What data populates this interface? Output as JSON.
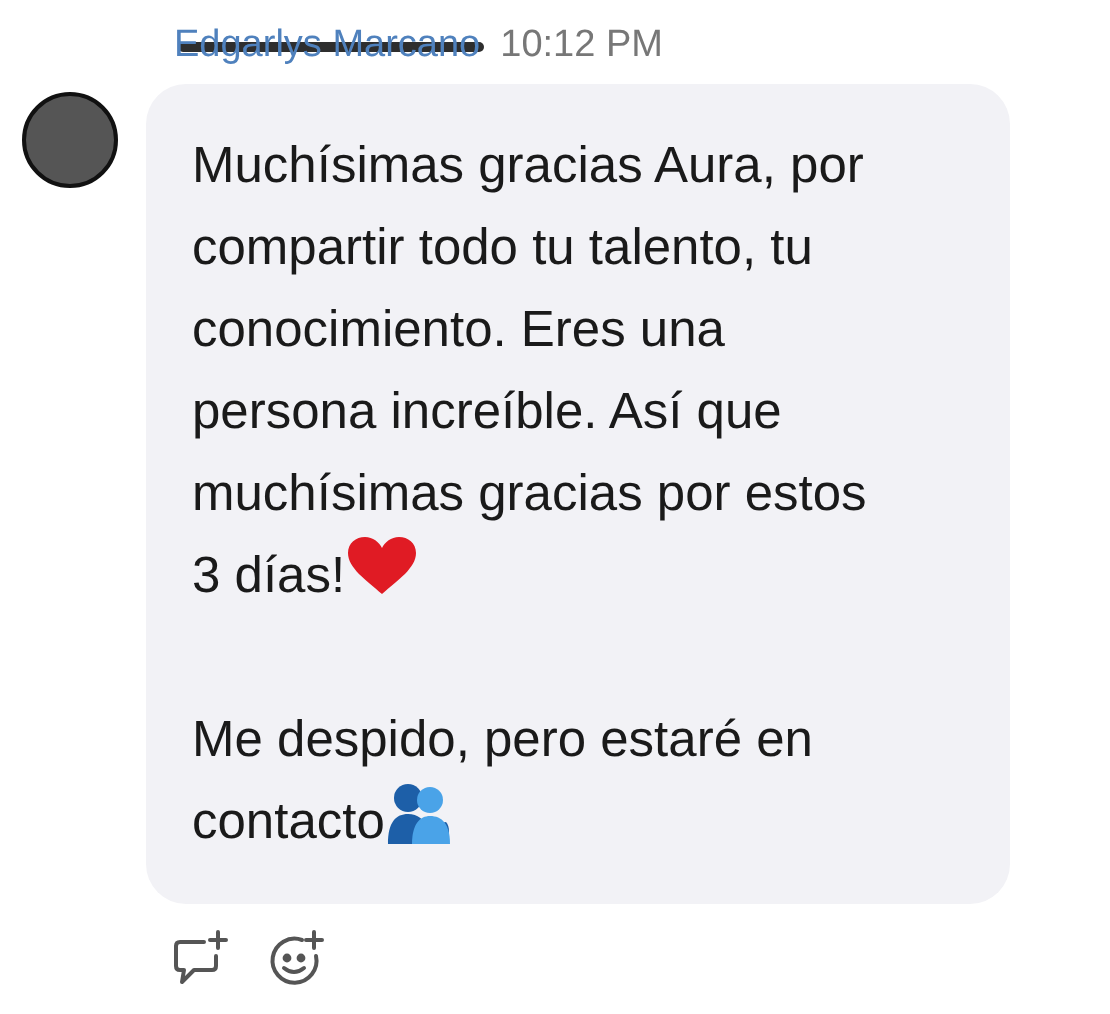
{
  "message": {
    "sender": "Edgarlys Marcano",
    "sender_redacted": true,
    "time": "10:12 PM",
    "paragraphs": [
      {
        "lines": [
          "Muchísimas gracias Aura, por",
          "compartir todo tu talento, tu",
          "conocimiento. Eres una",
          "persona increíble. Así que",
          "muchísimas gracias por estos",
          "3 días!"
        ],
        "icon": {
          "kind": "heart"
        }
      },
      {
        "lines": [
          "Me despido, pero estaré en",
          "contacto"
        ],
        "icon": {
          "kind": "hug"
        }
      }
    ]
  },
  "actions": [
    {
      "kind": "reply"
    },
    {
      "kind": "react"
    }
  ]
}
